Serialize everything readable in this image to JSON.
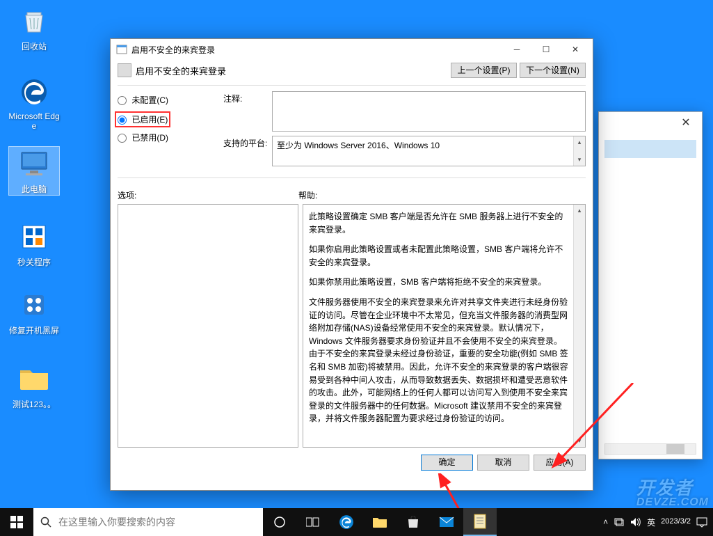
{
  "desktop": {
    "icons": [
      {
        "label": "回收站",
        "key": "recycle-bin"
      },
      {
        "label": "Microsoft Edge",
        "key": "edge"
      },
      {
        "label": "此电脑",
        "key": "this-pc"
      },
      {
        "label": "秒关程序",
        "key": "quick-close"
      },
      {
        "label": "修复开机黑屏",
        "key": "fix-boot"
      },
      {
        "label": "测试123。。",
        "key": "test-folder"
      }
    ]
  },
  "taskbar": {
    "search_placeholder": "在这里输入你要搜索的内容",
    "tray": {
      "ime": "英",
      "time": "2023/3/2"
    }
  },
  "dialog": {
    "title": "启用不安全的来宾登录",
    "header_title": "启用不安全的来宾登录",
    "prev_btn": "上一个设置(P)",
    "next_btn": "下一个设置(N)",
    "radios": {
      "not_configured": "未配置(C)",
      "enabled": "已启用(E)",
      "disabled": "已禁用(D)"
    },
    "comment_label": "注释:",
    "platform_label": "支持的平台:",
    "platform_value": "至少为 Windows Server 2016、Windows 10",
    "options_label": "选项:",
    "help_label": "帮助:",
    "help_paragraphs": [
      "此策略设置确定 SMB 客户端是否允许在 SMB 服务器上进行不安全的来宾登录。",
      "如果你启用此策略设置或者未配置此策略设置，SMB 客户端将允许不安全的来宾登录。",
      "如果你禁用此策略设置，SMB 客户端将拒绝不安全的来宾登录。",
      "文件服务器使用不安全的来宾登录来允许对共享文件夹进行未经身份验证的访问。尽管在企业环境中不太常见，但充当文件服务器的消费型网络附加存储(NAS)设备经常使用不安全的来宾登录。默认情况下，Windows 文件服务器要求身份验证并且不会使用不安全的来宾登录。由于不安全的来宾登录未经过身份验证，重要的安全功能(例如 SMB 签名和 SMB 加密)将被禁用。因此，允许不安全的来宾登录的客户端很容易受到各种中间人攻击，从而导致数据丢失、数据损坏和遭受恶意软件的攻击。此外，可能网络上的任何人都可以访问写入到使用不安全来宾登录的文件服务器中的任何数据。Microsoft 建议禁用不安全的来宾登录，并将文件服务器配置为要求经过身份验证的访问。"
    ],
    "buttons": {
      "ok": "确定",
      "cancel": "取消",
      "apply": "应用(A)"
    }
  },
  "watermark": {
    "line1": "开发者",
    "line2": "DEVZE.COM"
  }
}
